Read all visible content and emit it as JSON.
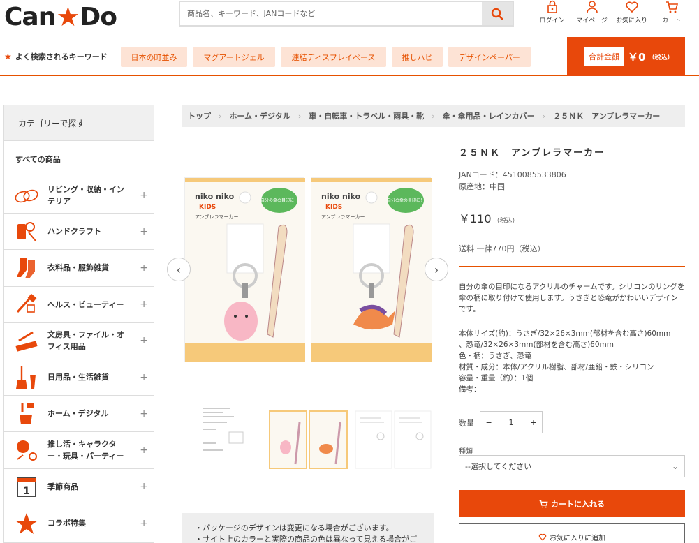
{
  "header": {
    "logo_left": "Can",
    "logo_right": "Do",
    "search_placeholder": "商品名、キーワード、JANコードなど",
    "icons": [
      {
        "label": "ログイン",
        "icon": "lock-icon"
      },
      {
        "label": "マイページ",
        "icon": "person-icon"
      },
      {
        "label": "お気に入り",
        "icon": "heart-icon"
      },
      {
        "label": "カート",
        "icon": "cart-icon"
      }
    ]
  },
  "keywords": {
    "title": "よく検索されるキーワード",
    "items": [
      "日本の町並み",
      "マグアートジェル",
      "連結ディスプレイベース",
      "推しハピ",
      "デザインペーパー"
    ]
  },
  "total": {
    "label": "合計金額",
    "amount": "￥0",
    "tax": "（税込）"
  },
  "sidebar": {
    "title": "カテゴリーで探す",
    "all": "すべての商品",
    "items": [
      {
        "label": "リビング・収納・インテリア",
        "icon": "living-icon"
      },
      {
        "label": "ハンドクラフト",
        "icon": "handcraft-icon"
      },
      {
        "label": "衣料品・服飾雑貨",
        "icon": "clothing-icon"
      },
      {
        "label": "ヘルス・ビューティー",
        "icon": "beauty-icon"
      },
      {
        "label": "文房具・ファイル・オフィス用品",
        "icon": "stationery-icon"
      },
      {
        "label": "日用品・生活雑貨",
        "icon": "daily-goods-icon"
      },
      {
        "label": "ホーム・デジタル",
        "icon": "home-digital-icon"
      },
      {
        "label": "推し活・キャラクター・玩具・パーティー",
        "icon": "party-icon"
      },
      {
        "label": "季節商品",
        "icon": "calendar-icon"
      },
      {
        "label": "コラボ特集",
        "icon": "star-icon"
      }
    ]
  },
  "breadcrumb": [
    "トップ",
    "ホーム・デジタル",
    "車・自転車・トラベル・雨具・靴",
    "傘・傘用品・レインカバー",
    "２５ＮＫ　アンブレラマーカー"
  ],
  "gallery": {
    "package_brand": "niko niko",
    "package_sub": "KIDS",
    "package_name": "アンブレラマーカー",
    "package_bubble": "自分の傘の目印に！"
  },
  "notice": [
    "・パッケージのデザインは変更になる場合がございます。",
    "・サイト上のカラーと実際の商品の色は異なって見える場合がご"
  ],
  "product": {
    "title": "２５ＮＫ　アンブレラマーカー",
    "jan": "JANコード：4510085533806",
    "origin": "原産地：中国",
    "price": "￥110",
    "price_tax": "（税込）",
    "shipping": "送料 一律770円（税込）",
    "description": "自分の傘の目印になるアクリルのチャームです。シリコンのリングを傘の柄に取り付けて使用します。うさぎと恐竜がかわいいデザインです。",
    "specs": [
      "本体サイズ(約)：うさぎ/32×26×3mm(部材を含む高さ)60mm",
      "、恐竜/32×26×3mm(部材を含む高さ)60mm",
      "色・柄：うさぎ、恐竜",
      "材質・成分：本体/アクリル樹脂、部材/亜鉛・鉄・シリコン",
      "容量・重量（約）：1個",
      "備考："
    ],
    "qty_label": "数量",
    "qty": "1",
    "kind_label": "種類",
    "select_value": "--選択してください",
    "cart_button": "カートに入れる",
    "fav_button": "お気に入りに追加"
  },
  "colors": {
    "accent": "#e8480b",
    "keyword_bg": "#fde3d5"
  }
}
